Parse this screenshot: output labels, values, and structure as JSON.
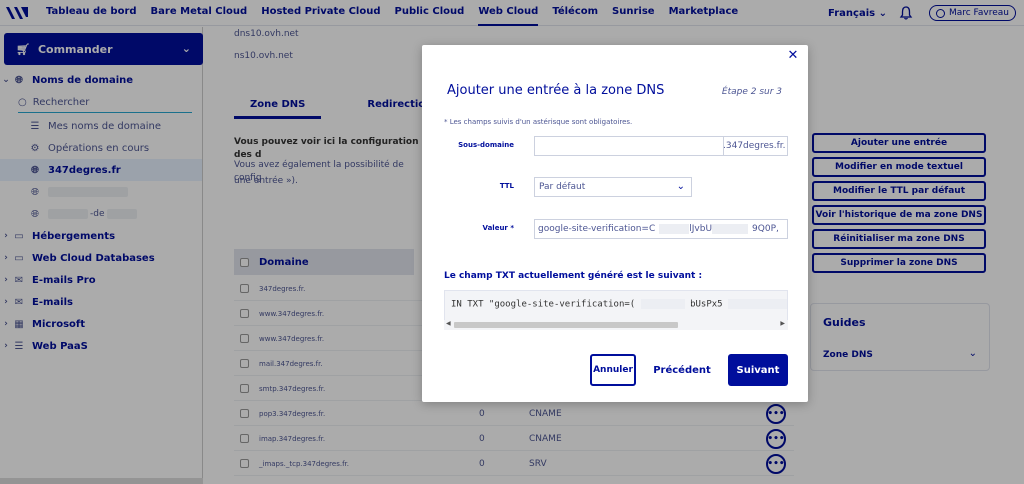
{
  "topnav": {
    "items": [
      "Tableau de bord",
      "Bare Metal Cloud",
      "Hosted Private Cloud",
      "Public Cloud",
      "Web Cloud",
      "Télécom",
      "Sunrise",
      "Marketplace"
    ],
    "active_index": 4,
    "language": "Français",
    "user_name": "Marc Favreau"
  },
  "sidebar": {
    "order_button": "Commander",
    "domains_label": "Noms de domaine",
    "search_placeholder": "Rechercher",
    "my_domains": "Mes noms de domaine",
    "ops_in_progress": "Opérations en cours",
    "selected_domain": "347degres.fr",
    "masked_suffix": "-de",
    "sections": [
      "Hébergements",
      "Web Cloud Databases",
      "E-mails Pro",
      "E-mails",
      "Microsoft",
      "Web PaaS"
    ]
  },
  "main": {
    "dns_servers": [
      "dns10.ovh.net",
      "ns10.ovh.net"
    ],
    "tabs": [
      "Zone DNS",
      "Redirection"
    ],
    "info_bold": "Vous pouvez voir ici la configuration des d",
    "info_text_1": "Vous avez également la possibilité de config",
    "info_text_2": "une entrée »).",
    "actions": [
      "Ajouter une entrée",
      "Modifier en mode textuel",
      "Modifier le TTL par défaut",
      "Voir l'historique de ma zone DNS",
      "Réinitialiser ma zone DNS",
      "Supprimer la zone DNS"
    ],
    "guides_title": "Guides",
    "guides_link": "Zone DNS",
    "table_header": "Domaine",
    "rows": [
      {
        "domain": "347degres.fr.",
        "ttl": "",
        "type": ""
      },
      {
        "domain": "www.347degres.fr.",
        "ttl": "",
        "type": ""
      },
      {
        "domain": "www.347degres.fr.",
        "ttl": "",
        "type": ""
      },
      {
        "domain": "mail.347degres.fr.",
        "ttl": "",
        "type": ""
      },
      {
        "domain": "smtp.347degres.fr.",
        "ttl": "",
        "type": ""
      },
      {
        "domain": "pop3.347degres.fr.",
        "ttl": "0",
        "type": "CNAME"
      },
      {
        "domain": "imap.347degres.fr.",
        "ttl": "0",
        "type": "CNAME"
      },
      {
        "domain": "_imaps._tcp.347degres.fr.",
        "ttl": "0",
        "type": "SRV"
      }
    ]
  },
  "modal": {
    "title": "Ajouter une entrée à la zone DNS",
    "step": "Étape 2 sur 3",
    "required_note": "* Les champs suivis d'un astérisque sont obligatoires.",
    "subdomain_label": "Sous-domaine",
    "subdomain_value": "",
    "subdomain_suffix": ".347degres.fr.",
    "ttl_label": "TTL",
    "ttl_value": "Par défaut",
    "value_label": "Valeur *",
    "value_prefix": "google-site-verification=C",
    "value_mid": "lJvbU",
    "value_end": "9Q0P,",
    "txt_label": "Le champ TXT actuellement généré est le suivant :",
    "txt_prefix": "IN TXT \"google-site-verification=(",
    "txt_mid": "bUsPx5",
    "cancel": "Annuler",
    "previous": "Précédent",
    "next": "Suivant"
  }
}
